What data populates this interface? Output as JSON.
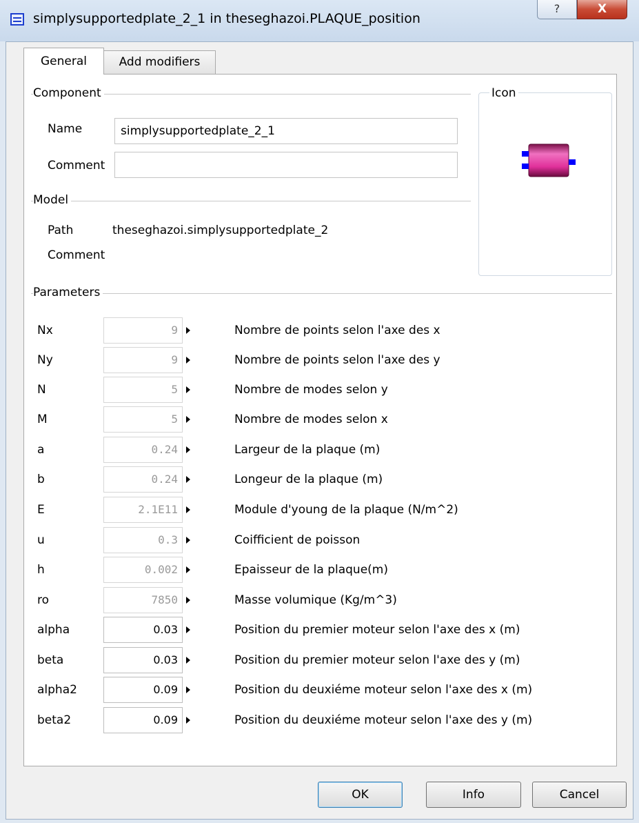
{
  "window": {
    "title": "simplysupportedplate_2_1 in theseghazoi.PLAQUE_position",
    "help_label": "?",
    "close_label": "X"
  },
  "tabs": [
    {
      "label": "General",
      "active": true
    },
    {
      "label": "Add modifiers",
      "active": false
    }
  ],
  "component": {
    "group_label": "Component",
    "name_label": "Name",
    "name_value": "simplysupportedplate_2_1",
    "comment_label": "Comment",
    "comment_value": ""
  },
  "icon_group": {
    "label": "Icon",
    "icon": "magenta-block-component-icon"
  },
  "model": {
    "group_label": "Model",
    "path_label": "Path",
    "path_value": "theseghazoi.simplysupportedplate_2",
    "comment_label": "Comment",
    "comment_value": ""
  },
  "parameters": {
    "group_label": "Parameters",
    "items": [
      {
        "name": "Nx",
        "value": "9",
        "description": "Nombre de points selon l'axe des x"
      },
      {
        "name": "Ny",
        "value": "9",
        "description": "Nombre de points selon l'axe des y"
      },
      {
        "name": "N",
        "value": "5",
        "description": "Nombre de modes selon y"
      },
      {
        "name": "M",
        "value": "5",
        "description": "Nombre de modes selon x"
      },
      {
        "name": "a",
        "value": "0.24",
        "description": "Largeur de la plaque (m)"
      },
      {
        "name": "b",
        "value": "0.24",
        "description": "Longeur de la plaque (m)"
      },
      {
        "name": "E",
        "value": "2.1E11",
        "description": "Module d'young de la plaque (N/m^2)"
      },
      {
        "name": "u",
        "value": "0.3",
        "description": "Coifficient de poisson"
      },
      {
        "name": "h",
        "value": "0.002",
        "description": "Epaisseur de la plaque(m)"
      },
      {
        "name": "ro",
        "value": "7850",
        "description": "Masse volumique (Kg/m^3)"
      },
      {
        "name": "alpha",
        "value": "0.03",
        "description": "Position du premier moteur selon l'axe des x (m)"
      },
      {
        "name": "beta",
        "value": "0.03",
        "description": "Position du premier moteur selon l'axe des y (m)"
      },
      {
        "name": "alpha2",
        "value": "0.09",
        "description": "Position du deuxiéme moteur selon l'axe des x (m)"
      },
      {
        "name": "beta2",
        "value": "0.09",
        "description": "Position du deuxiéme moteur selon l'axe des y (m)"
      }
    ]
  },
  "buttons": {
    "ok": "OK",
    "info": "Info",
    "cancel": "Cancel"
  },
  "colors": {
    "icon_fill": "#e0309a",
    "connector": "#0000ff"
  }
}
